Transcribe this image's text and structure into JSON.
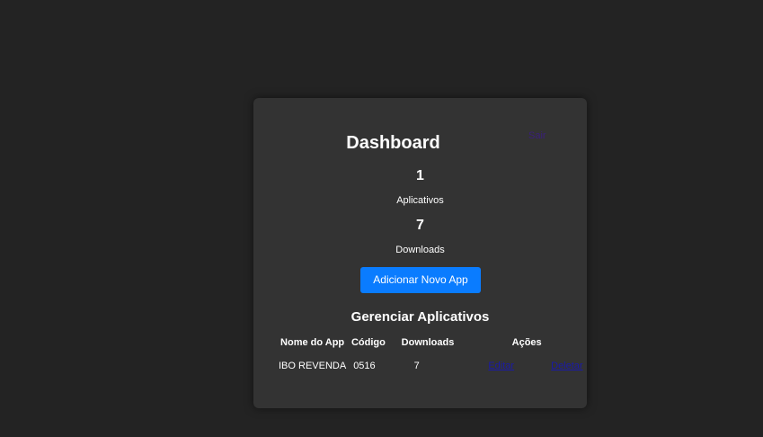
{
  "header": {
    "title": "Dashboard",
    "logout_label": "Sair"
  },
  "stats": [
    {
      "value": "1",
      "label": "Aplicativos"
    },
    {
      "value": "7",
      "label": "Downloads"
    }
  ],
  "add_button_label": "Adicionar Novo App",
  "section_title": "Gerenciar Aplicativos",
  "table": {
    "headers": [
      "Nome do App",
      "Código",
      "Downloads",
      "Ações"
    ],
    "rows": [
      {
        "name": "IBO REVENDA",
        "code": "0516",
        "downloads": "7",
        "edit_label": "Editar",
        "delete_label": "Deletar"
      }
    ]
  },
  "colors": {
    "background": "#232323",
    "card": "#333333",
    "accent": "#0a7cff",
    "link": "#1a1aa8"
  }
}
